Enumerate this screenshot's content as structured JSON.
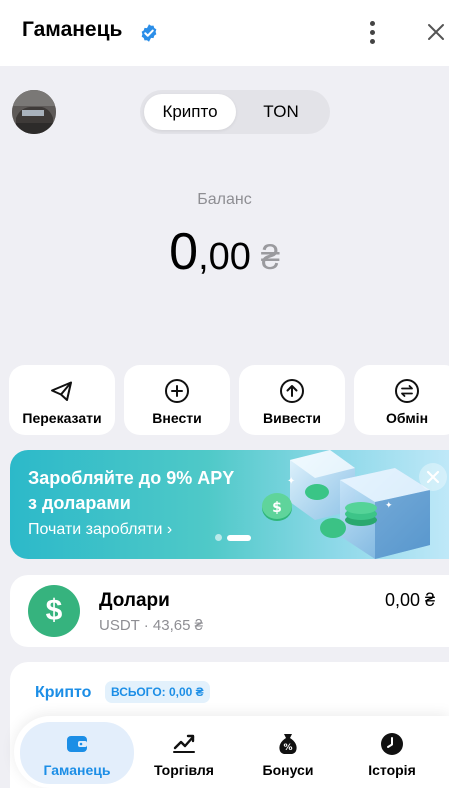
{
  "header": {
    "title": "Гаманець",
    "verified_icon": "verified-badge-icon",
    "more_icon": "more-vertical-icon",
    "close_icon": "close-icon",
    "accent_color": "#2b8ee8"
  },
  "segment": {
    "options": [
      "Крипто",
      "TON"
    ],
    "selected": "Крипто"
  },
  "balance": {
    "label": "Баланс",
    "integer": "0",
    "decimal": ",00",
    "currency": "₴"
  },
  "actions": [
    {
      "label": "Переказати",
      "icon": "send-icon"
    },
    {
      "label": "Внести",
      "icon": "plus-circle-icon"
    },
    {
      "label": "Вивести",
      "icon": "arrow-up-circle-icon"
    },
    {
      "label": "Обмін",
      "icon": "exchange-icon"
    }
  ],
  "banner": {
    "line1": "Заробляйте до 9% APY",
    "line2": "з доларами",
    "link": "Почати заробляти ›",
    "close_icon": "close-icon",
    "page_index": 2,
    "page_count": 2
  },
  "asset": {
    "name": "Долари",
    "sub": "USDT · 43,65 ₴",
    "amount": "0,00 ₴",
    "icon": "dollar-icon",
    "color": "#36b37e"
  },
  "crypto": {
    "title": "Крипто",
    "total": "ВСЬОГО: 0,00 ₴"
  },
  "tabbar": [
    {
      "label": "Гаманець",
      "icon": "wallet-icon",
      "active": true
    },
    {
      "label": "Торгівля",
      "icon": "chart-trend-icon",
      "active": false
    },
    {
      "label": "Бонуси",
      "icon": "money-bag-icon",
      "active": false
    },
    {
      "label": "Історія",
      "icon": "clock-icon",
      "active": false
    }
  ]
}
